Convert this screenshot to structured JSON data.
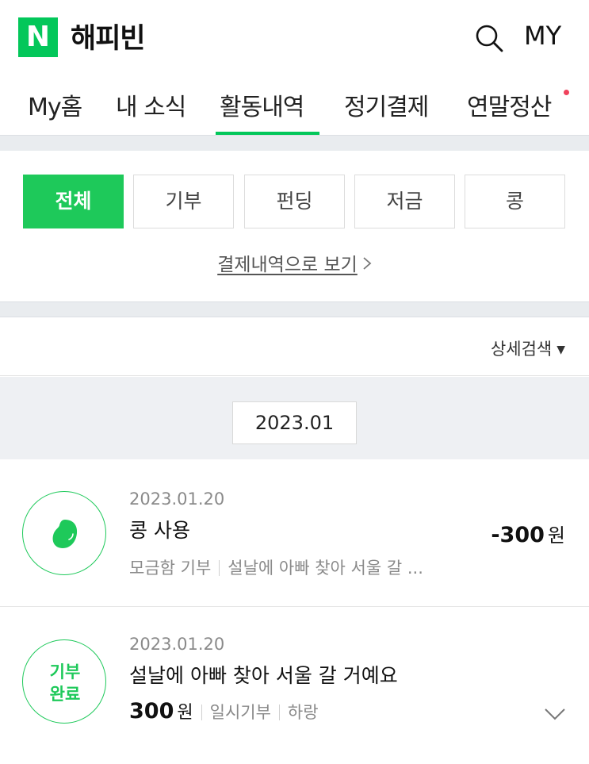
{
  "header": {
    "logo_letter": "N",
    "logo_color": "#03c75a",
    "app_title": "해피빈",
    "search_icon": "search-icon",
    "my_label": "MY"
  },
  "tabs": [
    {
      "label": "My홈",
      "active": false
    },
    {
      "label": "내 소식",
      "active": false
    },
    {
      "label": "활동내역",
      "active": true
    },
    {
      "label": "정기결제",
      "active": false
    },
    {
      "label": "연말정산",
      "active": false,
      "has_dot": true
    }
  ],
  "filters": [
    {
      "label": "전체",
      "active": true
    },
    {
      "label": "기부",
      "active": false
    },
    {
      "label": "펀딩",
      "active": false
    },
    {
      "label": "저금",
      "active": false
    },
    {
      "label": "콩",
      "active": false
    }
  ],
  "payment_link": "결제내역으로 보기",
  "detail_search": "상세검색",
  "month": "2023.01",
  "items": [
    {
      "date": "2023.01.20",
      "title": "콩 사용",
      "category": "모금함 기부",
      "description": "설날에 아빠 찾아 서울 갈 ...",
      "amount": "-300",
      "unit": "원",
      "icon": "bean-icon"
    },
    {
      "date": "2023.01.20",
      "title": "설날에 아빠 찾아 서울 갈 거예요",
      "status_line1": "기부",
      "status_line2": "완료",
      "amount": "300",
      "unit": "원",
      "type": "일시기부",
      "org": "하랑"
    }
  ],
  "accent_color": "#1ec95a"
}
